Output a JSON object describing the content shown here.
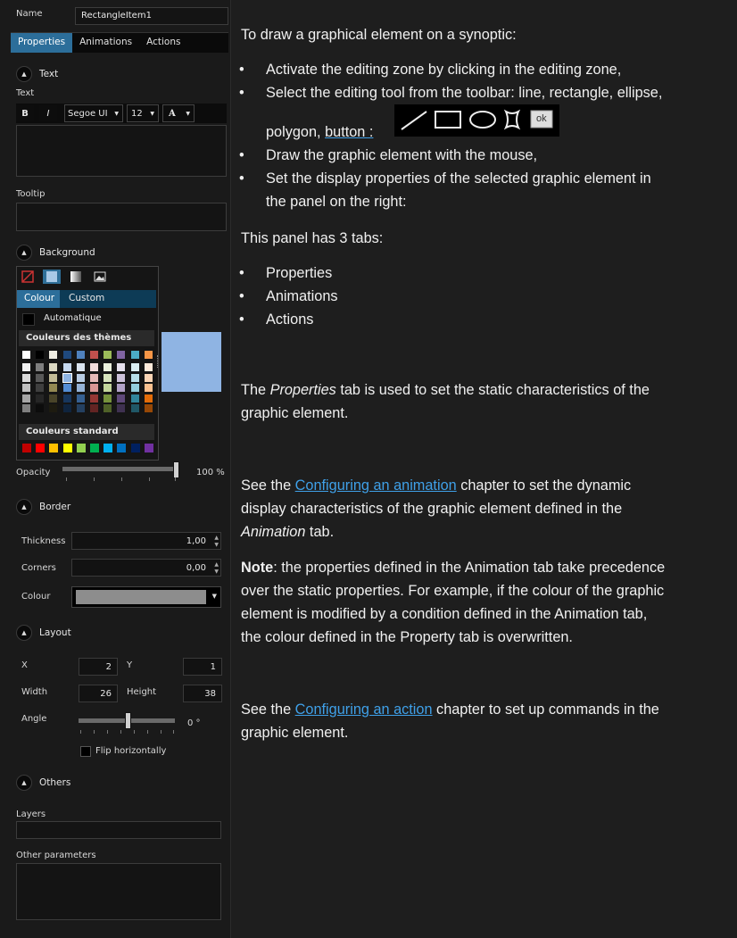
{
  "panel": {
    "name_label": "Name",
    "name_value": "RectangleItem1",
    "tabs": [
      "Properties",
      "Animations",
      "Actions"
    ],
    "text_section": "Text",
    "text_label": "Text",
    "font_toolbar": {
      "bold": "B",
      "italic": "I",
      "font": "Segoe UI",
      "size": "12",
      "color": "A"
    },
    "tooltip_label": "Tooltip",
    "background_section": "Background",
    "picker": {
      "tabs": [
        "Colour",
        "Custom"
      ],
      "auto": "Automatique",
      "themes": "Couleurs des thèmes",
      "standard": "Couleurs standard"
    },
    "selected_color": "#8fb4e3",
    "opacity_label": "Opacity",
    "opacity_value": "100 %",
    "border_section": "Border",
    "thickness_label": "Thickness",
    "thickness_value": "1,00",
    "corners_label": "Corners",
    "corners_value": "0,00",
    "colour_label": "Colour",
    "layout_section": "Layout",
    "x_label": "X",
    "x_value": "2",
    "y_label": "Y",
    "y_value": "1",
    "width_label": "Width",
    "width_value": "26",
    "height_label": "Height",
    "height_value": "38",
    "angle_label": "Angle",
    "angle_value": "0 °",
    "flip_label": "Flip horizontally",
    "others_section": "Others",
    "layers_label": "Layers",
    "other_params_label": "Other parameters"
  },
  "help": {
    "intro": "To draw a graphical element on a synoptic:",
    "b1": "Activate the editing zone by clicking in the editing zone,",
    "b2a": "Select the editing tool from the toolbar: line, rectangle, ellipse,",
    "b2b": "polygon,",
    "b2link": "button :",
    "palette_ok": "ok",
    "b3": "Draw the graphic element with the mouse,",
    "b4a": "Set the display properties of the selected graphic element in",
    "b4b": "the panel on the right:",
    "tabs_intro": "This panel has 3 tabs:",
    "tab1": "Properties",
    "tab2": "Animations",
    "tab3": "Actions",
    "prop_a1": "The ",
    "prop_em": "Properties",
    "prop_a2": " tab is used to set the static characteristics of the",
    "prop_b": "graphic element.",
    "anim_a1": "See the ",
    "anim_link": "Configuring an animation",
    "anim_a2": " chapter to set the dynamic",
    "anim_b": "display characteristics of the graphic element defined in the",
    "anim_c_em": "Animation",
    "anim_c2": " tab.",
    "note_bold": "Note",
    "note_a": ": the properties defined in the Animation tab take precedence",
    "note_b": "over the static properties. For example, if the colour of the graphic",
    "note_c": "element is modified by a condition defined in the Animation tab,",
    "note_d": "the colour defined in the Property tab is overwritten.",
    "act_a1": "See the ",
    "act_link": "Configuring an action",
    "act_a2": " chapter to set up commands in the",
    "act_b": "graphic element."
  }
}
